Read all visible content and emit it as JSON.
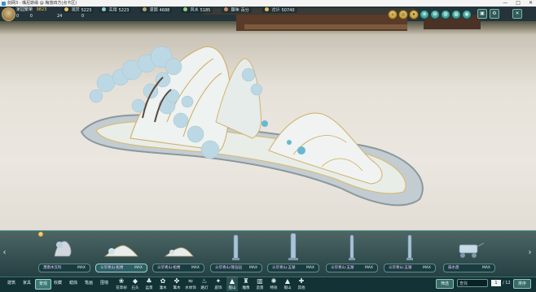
{
  "window": {
    "title": "剑网3 - 嘴尼斯缘 @ 梅落四方(点卡区)",
    "controls": [
      "—",
      "□",
      "✕"
    ]
  },
  "hud": {
    "prosperity_label": "家园繁荣",
    "prosperity_value": "9823",
    "sub_left": [
      "0",
      "0"
    ],
    "sub_mid": [
      "24",
      "0"
    ],
    "stats": [
      {
        "label": "观赏",
        "value": "5223",
        "color": "#e6c35a"
      },
      {
        "label": "实用",
        "value": "5223",
        "color": "#8fd0c8"
      },
      {
        "label": "坚固",
        "value": "4688",
        "color": "#c0a070"
      },
      {
        "label": "风水",
        "value": "5185",
        "color": "#9ad07a"
      },
      {
        "label": "趣味",
        "value": "百分",
        "color": "#d08a6a"
      },
      {
        "label": "合计",
        "value": "50740",
        "color": "#e0c060"
      }
    ],
    "right_icons": [
      "home-icon",
      "coin-icon",
      "star-icon",
      "gear-icon",
      "chat-icon",
      "user-icon",
      "bag-icon",
      "camera-icon",
      "map-icon"
    ],
    "right_buttons": [
      "▣",
      "⚙",
      "✕"
    ]
  },
  "catalog": {
    "items": [
      {
        "name": "濮南木叉料",
        "max": "MAX",
        "icon": "rock-mountain-icon"
      },
      {
        "name": "斗华青山·松楼",
        "max": "MAX",
        "icon": "jade-mountain-icon",
        "selected": true
      },
      {
        "name": "斗华青山·松楼",
        "max": "MAX",
        "icon": "jade-mountain-small-icon"
      },
      {
        "name": "斗华青山·隆岳园",
        "max": "MAX",
        "icon": "lamp-pillar-icon"
      },
      {
        "name": "斗华青山·五湖",
        "max": "MAX",
        "icon": "lamp-pillar-icon"
      },
      {
        "name": "斗华青山·五湖",
        "max": "MAX",
        "icon": "lamp-pillar-icon"
      },
      {
        "name": "斗华青山·五湖",
        "max": "MAX",
        "icon": "lamp-pillar-icon"
      },
      {
        "name": "扇水盘",
        "max": "MAX",
        "icon": "cart-icon"
      }
    ],
    "prev": "‹",
    "next": "›"
  },
  "tabs": {
    "categories": [
      {
        "label": "建筑"
      },
      {
        "label": "家具"
      },
      {
        "label": "景观",
        "active": true
      },
      {
        "label": "收藏"
      },
      {
        "label": "蜡烛"
      },
      {
        "label": "笔画"
      },
      {
        "label": "围墙"
      }
    ],
    "subtabs": [
      {
        "label": "花草树",
        "glyph": "❀"
      },
      {
        "label": "石头",
        "glyph": "◆"
      },
      {
        "label": "盆景",
        "glyph": "♣"
      },
      {
        "label": "灌木",
        "glyph": "✿"
      },
      {
        "label": "篱木",
        "glyph": "✤"
      },
      {
        "label": "水体饰",
        "glyph": "≈"
      },
      {
        "label": "路灯",
        "glyph": "♨"
      },
      {
        "label": "庭饰",
        "glyph": "✦"
      },
      {
        "label": "假山",
        "glyph": "▲",
        "active": true
      },
      {
        "label": "雕像",
        "glyph": "♜"
      },
      {
        "label": "造景",
        "glyph": "▥"
      },
      {
        "label": "特效",
        "glyph": "✺"
      },
      {
        "label": "假山",
        "glyph": "▲"
      },
      {
        "label": "其他",
        "glyph": "✚"
      }
    ],
    "filter_label": "筛选",
    "search_placeholder": "查找",
    "page_current": "1",
    "page_total": "/ 12",
    "sort_label": "排序"
  }
}
